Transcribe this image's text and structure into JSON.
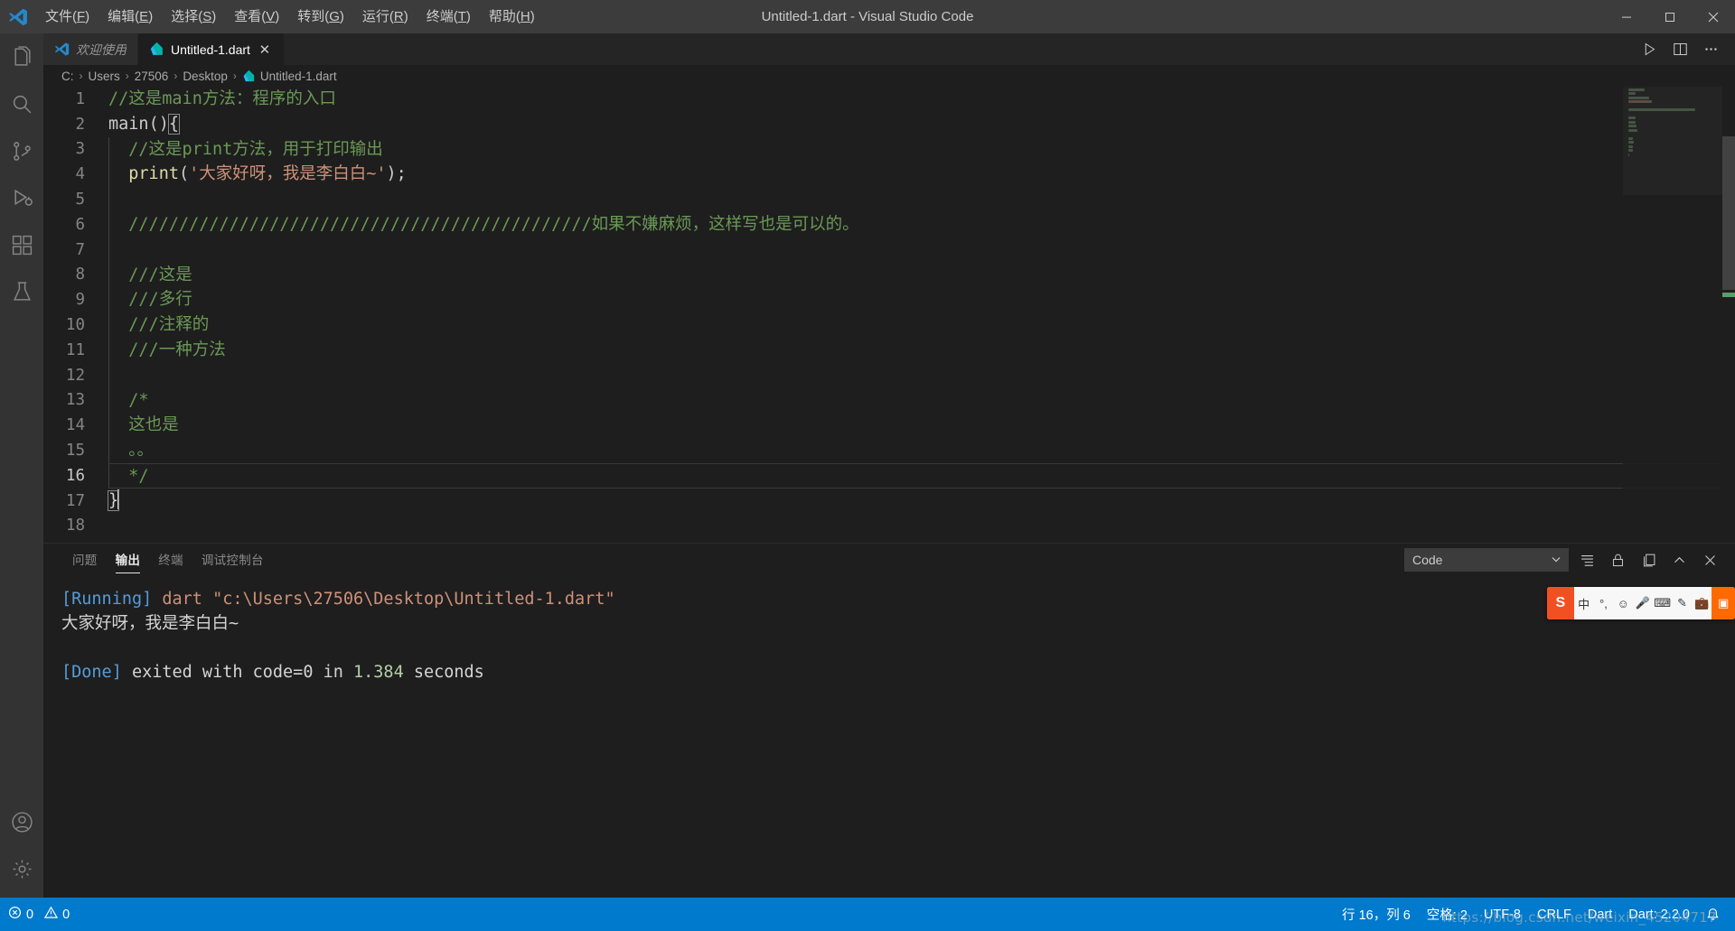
{
  "window": {
    "title": "Untitled-1.dart - Visual Studio Code",
    "minimize": "─",
    "maximize": "❐",
    "close": "✕"
  },
  "menu": [
    {
      "label": "文件(F)",
      "mnemonic": "F"
    },
    {
      "label": "编辑(E)",
      "mnemonic": "E"
    },
    {
      "label": "选择(S)",
      "mnemonic": "S"
    },
    {
      "label": "查看(V)",
      "mnemonic": "V"
    },
    {
      "label": "转到(G)",
      "mnemonic": "G"
    },
    {
      "label": "运行(R)",
      "mnemonic": "R"
    },
    {
      "label": "终端(T)",
      "mnemonic": "T"
    },
    {
      "label": "帮助(H)",
      "mnemonic": "H"
    }
  ],
  "activitybar": [
    {
      "name": "explorer",
      "icon": "files-icon",
      "active": false
    },
    {
      "name": "search",
      "icon": "search-icon",
      "active": false
    },
    {
      "name": "source-control",
      "icon": "source-control-icon",
      "active": false
    },
    {
      "name": "run-and-debug",
      "icon": "run-debug-icon",
      "active": false
    },
    {
      "name": "extensions",
      "icon": "extensions-icon",
      "active": false
    },
    {
      "name": "testing",
      "icon": "beaker-icon",
      "active": false
    },
    {
      "name": "accounts",
      "icon": "account-icon",
      "active": false
    },
    {
      "name": "settings",
      "icon": "gear-icon",
      "active": false
    }
  ],
  "tabs": [
    {
      "label": "欢迎使用",
      "icon": "vscode-icon",
      "active": false,
      "italic": true,
      "closable": false
    },
    {
      "label": "Untitled-1.dart",
      "icon": "dart-icon",
      "active": true,
      "italic": false,
      "closable": true,
      "close": "✕"
    }
  ],
  "editor_actions": [
    {
      "name": "run-button",
      "icon": "play-icon"
    },
    {
      "name": "split-editor-button",
      "icon": "split-icon"
    },
    {
      "name": "more-actions-button",
      "icon": "ellipsis-icon"
    }
  ],
  "breadcrumb": {
    "separator": "›",
    "items": [
      "C:",
      "Users",
      "27506",
      "Desktop",
      "Untitled-1.dart"
    ],
    "file_icon": "dart-icon"
  },
  "code": {
    "language": "dart",
    "lines": [
      {
        "n": 1,
        "indent": 0,
        "guide": false,
        "tokens": [
          {
            "t": "//这是main方法：程序的入口",
            "c": "comment"
          }
        ]
      },
      {
        "n": 2,
        "indent": 0,
        "guide": false,
        "tokens": [
          {
            "t": "main",
            "c": "plain"
          },
          {
            "t": "()",
            "c": "plain"
          },
          {
            "t": "{",
            "c": "bracket"
          }
        ]
      },
      {
        "n": 3,
        "indent": 1,
        "guide": true,
        "tokens": [
          {
            "t": "  //这是print方法，用于打印输出",
            "c": "comment"
          }
        ]
      },
      {
        "n": 4,
        "indent": 1,
        "guide": true,
        "tokens": [
          {
            "t": "  ",
            "c": "plain"
          },
          {
            "t": "print",
            "c": "function"
          },
          {
            "t": "(",
            "c": "plain"
          },
          {
            "t": "'大家好呀，我是李白白~'",
            "c": "string"
          },
          {
            "t": ");",
            "c": "plain"
          }
        ]
      },
      {
        "n": 5,
        "indent": 1,
        "guide": true,
        "tokens": []
      },
      {
        "n": 6,
        "indent": 1,
        "guide": true,
        "tokens": [
          {
            "t": "  //////////////////////////////////////////////如果不嫌麻烦，这样写也是可以的。",
            "c": "comment"
          }
        ]
      },
      {
        "n": 7,
        "indent": 1,
        "guide": true,
        "tokens": []
      },
      {
        "n": 8,
        "indent": 1,
        "guide": true,
        "tokens": [
          {
            "t": "  ///这是",
            "c": "comment"
          }
        ]
      },
      {
        "n": 9,
        "indent": 1,
        "guide": true,
        "tokens": [
          {
            "t": "  ///多行",
            "c": "comment"
          }
        ]
      },
      {
        "n": 10,
        "indent": 1,
        "guide": true,
        "tokens": [
          {
            "t": "  ///注释的",
            "c": "comment"
          }
        ]
      },
      {
        "n": 11,
        "indent": 1,
        "guide": true,
        "tokens": [
          {
            "t": "  ///一种方法",
            "c": "comment"
          }
        ]
      },
      {
        "n": 12,
        "indent": 1,
        "guide": true,
        "tokens": []
      },
      {
        "n": 13,
        "indent": 1,
        "guide": true,
        "tokens": [
          {
            "t": "  /*",
            "c": "comment"
          }
        ]
      },
      {
        "n": 14,
        "indent": 1,
        "guide": true,
        "tokens": [
          {
            "t": "  这也是",
            "c": "comment"
          }
        ]
      },
      {
        "n": 15,
        "indent": 1,
        "guide": true,
        "tokens": [
          {
            "t": "  。。",
            "c": "comment"
          }
        ]
      },
      {
        "n": 16,
        "indent": 1,
        "guide": true,
        "cursorline": true,
        "tokens": [
          {
            "t": "  */",
            "c": "comment"
          }
        ]
      },
      {
        "n": 17,
        "indent": 0,
        "guide": false,
        "caret": true,
        "tokens": [
          {
            "t": "}",
            "c": "bracket"
          }
        ]
      },
      {
        "n": 18,
        "indent": 0,
        "guide": false,
        "tokens": []
      }
    ]
  },
  "panel": {
    "tabs": [
      {
        "label": "问题",
        "active": false
      },
      {
        "label": "输出",
        "active": true
      },
      {
        "label": "终端",
        "active": false
      },
      {
        "label": "调试控制台",
        "active": false
      }
    ],
    "channel_select": {
      "value": "Code",
      "chevron": "⌄"
    },
    "actions": [
      {
        "name": "clear-output-button",
        "icon": "clear-icon"
      },
      {
        "name": "lock-scroll-button",
        "icon": "lock-icon"
      },
      {
        "name": "open-in-editor-button",
        "icon": "open-editor-icon"
      },
      {
        "name": "maximize-panel-button",
        "icon": "chevron-up-icon"
      },
      {
        "name": "close-panel-button",
        "icon": "close-icon"
      }
    ],
    "output": [
      {
        "segments": [
          {
            "t": "[Running]",
            "c": "tag"
          },
          {
            "t": " ",
            "c": "plain"
          },
          {
            "t": "dart \"c:\\Users\\27506\\Desktop\\Untitled-1.dart\"",
            "c": "cmd"
          }
        ]
      },
      {
        "segments": [
          {
            "t": "大家好呀，我是李白白~",
            "c": "plain"
          }
        ]
      },
      {
        "segments": []
      },
      {
        "segments": [
          {
            "t": "[Done]",
            "c": "tag"
          },
          {
            "t": " exited with ",
            "c": "plain"
          },
          {
            "t": "code=0",
            "c": "plain"
          },
          {
            "t": " in ",
            "c": "plain"
          },
          {
            "t": "1.384",
            "c": "num"
          },
          {
            "t": " seconds",
            "c": "plain"
          }
        ]
      }
    ]
  },
  "statusbar": {
    "background": "#007acc",
    "left": [
      {
        "name": "problems",
        "icon": "error-warning-icon",
        "label": "0",
        "label2": "0",
        "errors": "0",
        "warnings": "0"
      }
    ],
    "right": [
      {
        "name": "cursor-position",
        "label": "行 16，列 6"
      },
      {
        "name": "indentation",
        "label": "空格: 2"
      },
      {
        "name": "encoding",
        "label": "UTF-8"
      },
      {
        "name": "eol",
        "label": "CRLF"
      },
      {
        "name": "language-mode",
        "label": "Dart"
      },
      {
        "name": "dart-version",
        "label": "Dart: 2.2.0"
      },
      {
        "name": "notifications",
        "label": ""
      }
    ]
  },
  "ime": {
    "logo": "S",
    "items": [
      "中",
      "°,",
      "☺",
      "🎤",
      "⌨",
      "✎",
      "💼",
      "⚙"
    ],
    "badge": "▣"
  },
  "watermark": {
    "text": "https://blog.csdn.net/weixin_45204717"
  },
  "colors": {
    "accent": "#007acc",
    "titlebar": "#3c3c3c",
    "activitybar": "#333333",
    "editor_bg": "#1e1e1e",
    "tab_inactive": "#2d2d2d",
    "comment": "#6a9955",
    "string": "#ce9178",
    "function": "#dcdcaa",
    "keyword_blue": "#569cd6",
    "number": "#b5cea8"
  }
}
